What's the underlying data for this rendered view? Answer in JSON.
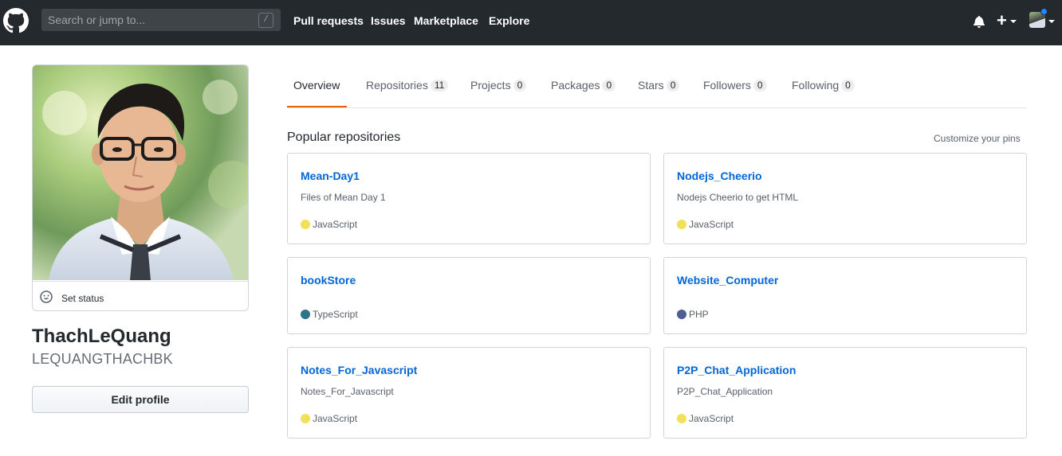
{
  "header": {
    "search_placeholder": "Search or jump to...",
    "search_shortcut": "/",
    "nav": [
      "Pull requests",
      "Issues",
      "Marketplace",
      "Explore"
    ],
    "plus_label": "+"
  },
  "profile": {
    "set_status": "Set status",
    "fullname": "ThachLeQuang",
    "username": "LEQUANGTHACHBK",
    "edit_button": "Edit profile"
  },
  "tabs": [
    {
      "label": "Overview",
      "count": null,
      "selected": true
    },
    {
      "label": "Repositories",
      "count": "11",
      "selected": false
    },
    {
      "label": "Projects",
      "count": "0",
      "selected": false
    },
    {
      "label": "Packages",
      "count": "0",
      "selected": false
    },
    {
      "label": "Stars",
      "count": "0",
      "selected": false
    },
    {
      "label": "Followers",
      "count": "0",
      "selected": false
    },
    {
      "label": "Following",
      "count": "0",
      "selected": false
    }
  ],
  "popular": {
    "title": "Popular repositories",
    "customize": "Customize your pins",
    "repos": [
      {
        "name": "Mean-Day1",
        "description": "Files of Mean Day 1",
        "language": "JavaScript",
        "lang_color": "#f1e05a"
      },
      {
        "name": "Nodejs_Cheerio",
        "description": "Nodejs Cheerio to get HTML",
        "language": "JavaScript",
        "lang_color": "#f1e05a"
      },
      {
        "name": "bookStore",
        "description": "",
        "language": "TypeScript",
        "lang_color": "#2b7489"
      },
      {
        "name": "Website_Computer",
        "description": "",
        "language": "PHP",
        "lang_color": "#4F5D95"
      },
      {
        "name": "Notes_For_Javascript",
        "description": "Notes_For_Javascript",
        "language": "JavaScript",
        "lang_color": "#f1e05a"
      },
      {
        "name": "P2P_Chat_Application",
        "description": "P2P_Chat_Application",
        "language": "JavaScript",
        "lang_color": "#f1e05a"
      }
    ]
  }
}
